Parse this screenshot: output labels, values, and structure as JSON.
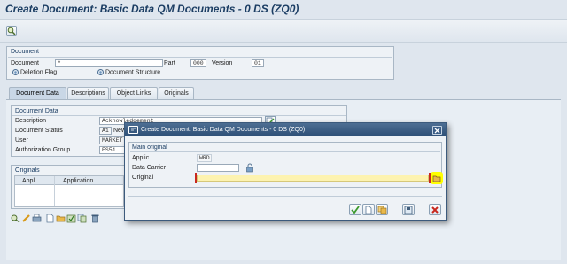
{
  "title": "Create Document: Basic Data QM Documents - 0 DS (ZQ0)",
  "document": {
    "group_title": "Document",
    "document_label": "Document",
    "document_value": "*",
    "part_label": "Part",
    "part_value": "000",
    "version_label": "Version",
    "version_value": "01",
    "deletion_flag_label": "Deletion Flag",
    "document_structure_label": "Document Structure"
  },
  "tabs": [
    {
      "label": "Document Data"
    },
    {
      "label": "Descriptions"
    },
    {
      "label": "Object Links"
    },
    {
      "label": "Originals"
    }
  ],
  "doc_data": {
    "group_title": "Document Data",
    "description_label": "Description",
    "description_value": "Acknowledgement",
    "status_label": "Document Status",
    "status_code": "A1",
    "status_text": "New",
    "user_label": "User",
    "user_value": "MARKET",
    "auth_label": "Authorization Group",
    "auth_value": "ES51"
  },
  "originals": {
    "group_title": "Originals",
    "columns": [
      "Appl.",
      "Application"
    ]
  },
  "dialog": {
    "title": "Create Document: Basic Data QM Documents - 0 DS (ZQ0)",
    "group_title": "Main original",
    "applic_label": "Applic.",
    "applic_value": "WRD",
    "carrier_label": "Data Carrier",
    "carrier_value": "",
    "original_label": "Original",
    "original_value": ""
  },
  "colors": {
    "title_text": "#1b3d63",
    "dialog_header": "#2d4f76",
    "original_field": "#fdf3b0",
    "highlight": "#ffff00",
    "cancel_red": "#c8281e",
    "ok_green": "#3c9a2c"
  },
  "icons": [
    "execute-icon",
    "edit-icon",
    "attachment-icon",
    "checkmark-icon",
    "cancel-icon"
  ]
}
